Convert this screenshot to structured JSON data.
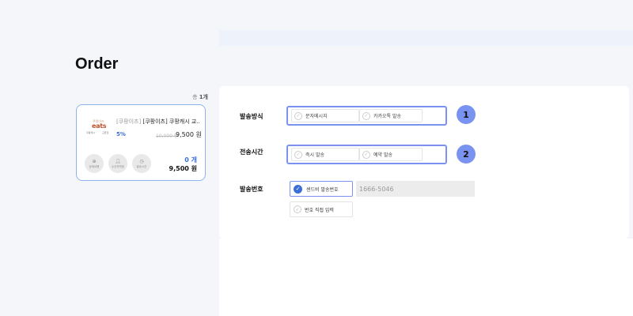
{
  "page": {
    "title": "Order"
  },
  "cart": {
    "count_prefix": "총",
    "count_value": "1개"
  },
  "product": {
    "thumb": {
      "top_text": "쿠팡이츠",
      "logo_text": "eats",
      "sub_left": "쿠팡캐시",
      "sub_right": "교환권"
    },
    "brand": "[쿠팡이츠]",
    "name": "[쿠팡이츠] 쿠팡캐시 교...",
    "discount": "5%",
    "original_price": "10,000 원",
    "price": "9,500 원",
    "quantity": "0 개",
    "total": "9,500 원",
    "actions": [
      {
        "label": "상세내용"
      },
      {
        "label": "수신자번호"
      },
      {
        "label": "발송시간"
      }
    ]
  },
  "form": {
    "send_method": {
      "label": "발송방식",
      "options": [
        "문자메시지",
        "카카오톡 발송"
      ],
      "badge": "1"
    },
    "send_time": {
      "label": "전송시간",
      "options": [
        "즉시 발송",
        "예약 발송"
      ],
      "badge": "2"
    },
    "send_number": {
      "label": "발송번호",
      "option_default": "센드비 발송번호",
      "option_custom": "번호 직접 입력",
      "phone_value": "1666-5046"
    }
  },
  "colors": {
    "accent": "#3b6fd8",
    "highlight": "#7b93f0",
    "card_border": "#8fb2ee"
  }
}
